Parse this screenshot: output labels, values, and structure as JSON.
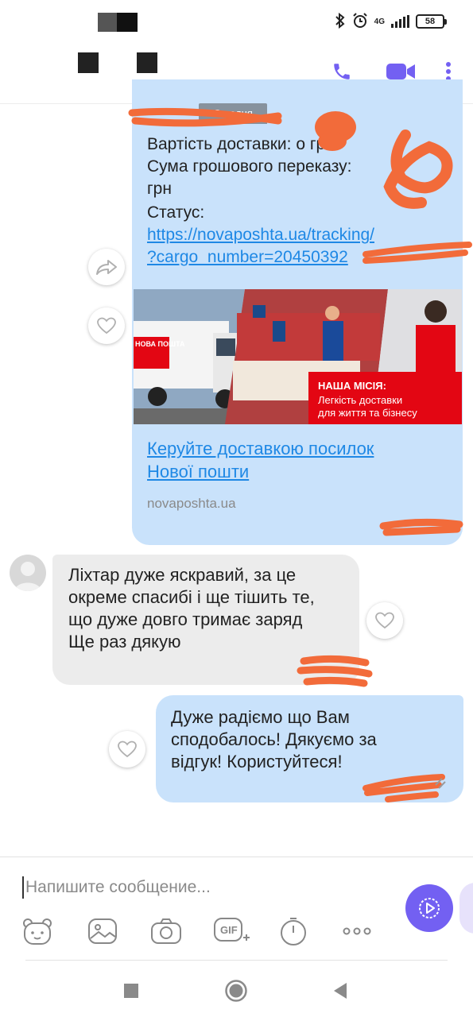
{
  "status_bar": {
    "network": "4G",
    "battery": "58",
    "icons": [
      "bluetooth-icon",
      "alarm-icon",
      "signal-icon",
      "battery-icon"
    ]
  },
  "header": {
    "icons": [
      "call-icon",
      "video-call-icon",
      "more-vertical-icon"
    ],
    "accent_color": "#7360f2"
  },
  "chat": {
    "date_chip": "Сегодня",
    "link_message": {
      "line_cost": "Вартість доставки: ",
      "line_cost_suffix": "о грн",
      "line_sum": "Сума грошового переказу: ",
      "line_sum_cont": "грн",
      "line_status": "Статус:",
      "url_line1": "https://novaposhta.ua/tracking/",
      "url_line2": "?cargo_number=20450392",
      "preview": {
        "banner_brand": "НОВА ПОШТА",
        "banner_heading": "НАША МІСІЯ:",
        "banner_line1": "Легкість доставки",
        "banner_line2": "для життя та бізнесу",
        "title_line1": "Керуйте доставкою посилок",
        "title_line2": "Нової пошти",
        "domain": "novaposhta.ua"
      }
    },
    "incoming_message": {
      "lines": [
        "Ліхтар дуже яскравий, за це",
        "окреме спасибі і ще тішить те,",
        "що дуже довго тримає заряд",
        "Ще раз дякую"
      ]
    },
    "outgoing_message": {
      "lines": [
        "Дуже радіємо що Вам",
        "сподобалось! Дякуємо за",
        "відгук! Користуйтеся!"
      ]
    }
  },
  "composer": {
    "placeholder": "Напишите сообщение...",
    "tools": [
      "sticker-icon",
      "gallery-icon",
      "camera-icon",
      "gif-icon",
      "timer-icon",
      "more-horizontal-icon"
    ],
    "gif_label": "GIF"
  },
  "navbar": {
    "buttons": [
      "recent-apps-button",
      "home-button",
      "back-button"
    ]
  },
  "colors": {
    "bubble_blue": "#c9e2fb",
    "bubble_grey": "#ececec",
    "link": "#1e88e5",
    "redaction": "#f26b3a",
    "brand_red": "#e30613"
  }
}
